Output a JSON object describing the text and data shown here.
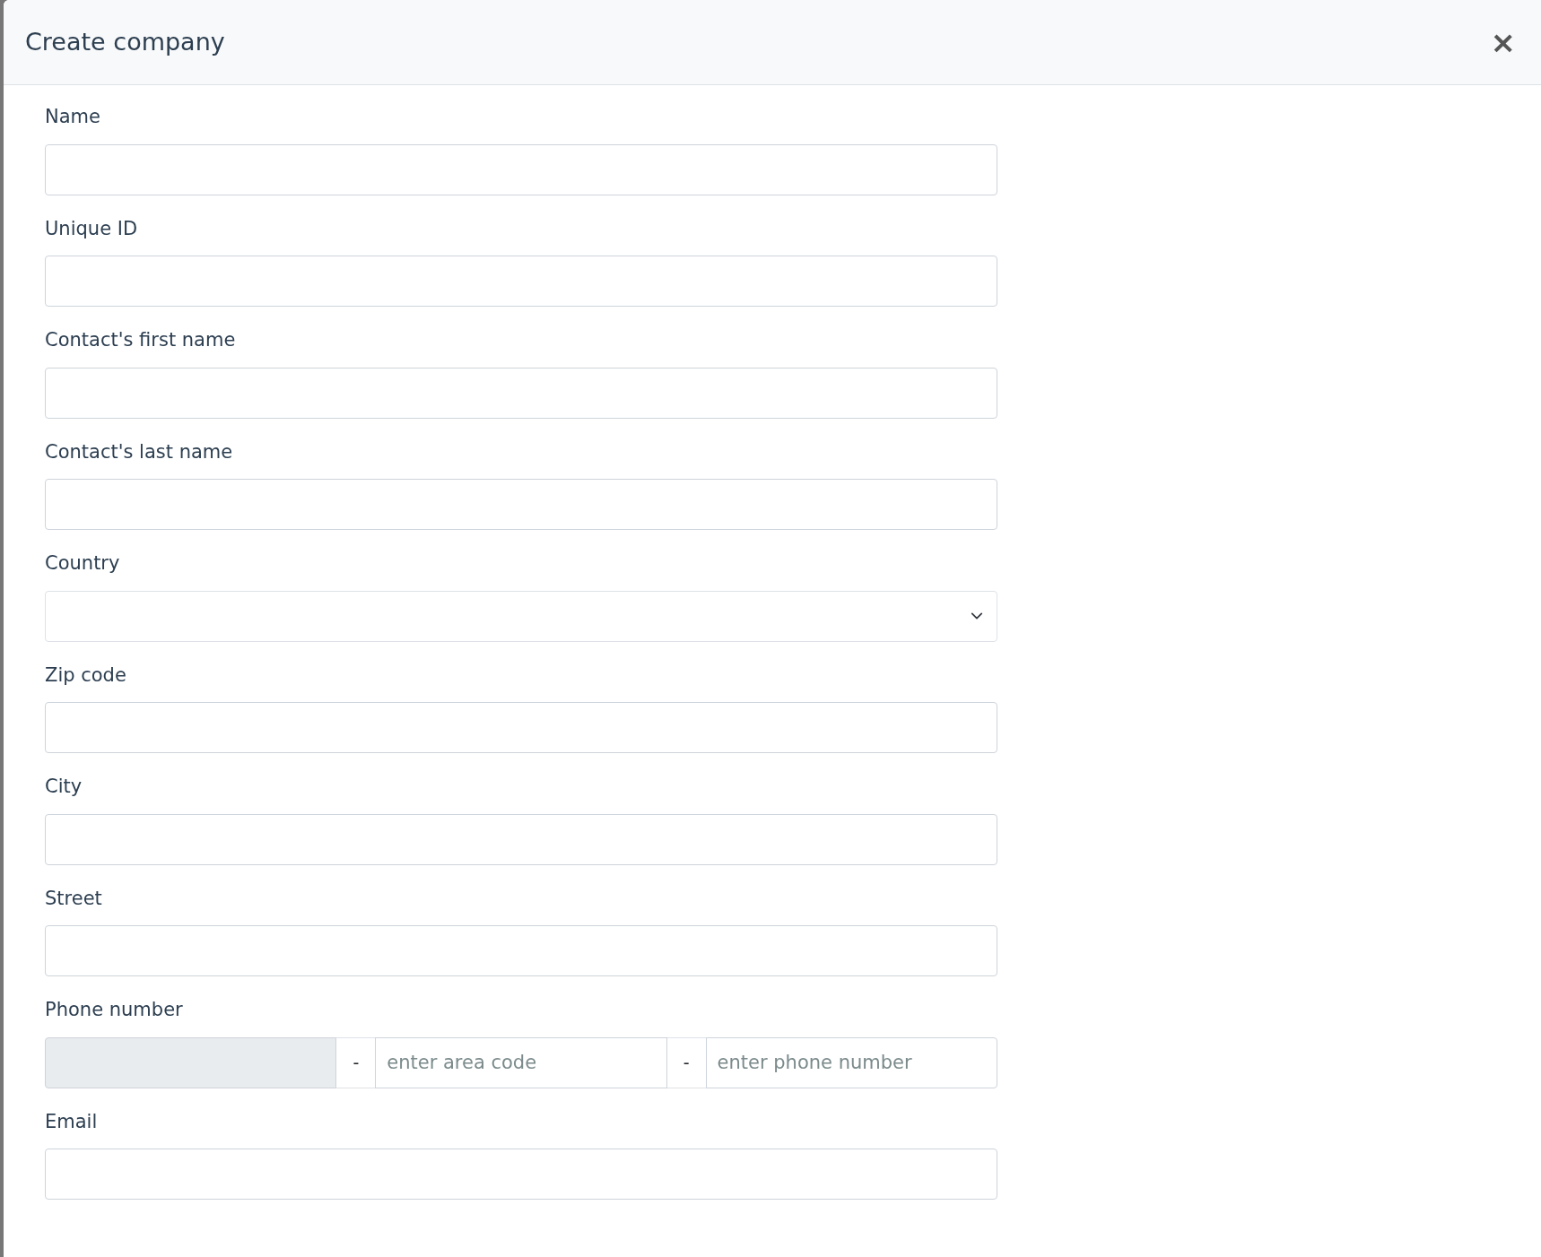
{
  "dialog": {
    "title": "Create company",
    "close": "×"
  },
  "fields": [
    {
      "kind": "text",
      "label": "Name"
    },
    {
      "kind": "text",
      "label": "Unique ID"
    },
    {
      "kind": "text",
      "label": "Contact's first name"
    },
    {
      "kind": "text",
      "label": "Contact's last name"
    },
    {
      "kind": "select",
      "label": "Country"
    },
    {
      "kind": "text",
      "label": "Zip code"
    },
    {
      "kind": "text",
      "label": "City"
    },
    {
      "kind": "text",
      "label": "Street"
    },
    {
      "kind": "phone",
      "label": "Phone number",
      "prefix_disabled": true,
      "separators": [
        "-",
        "-"
      ],
      "area_placeholder": "enter area code",
      "number_placeholder": "enter phone number"
    },
    {
      "kind": "text",
      "label": "Email"
    }
  ]
}
